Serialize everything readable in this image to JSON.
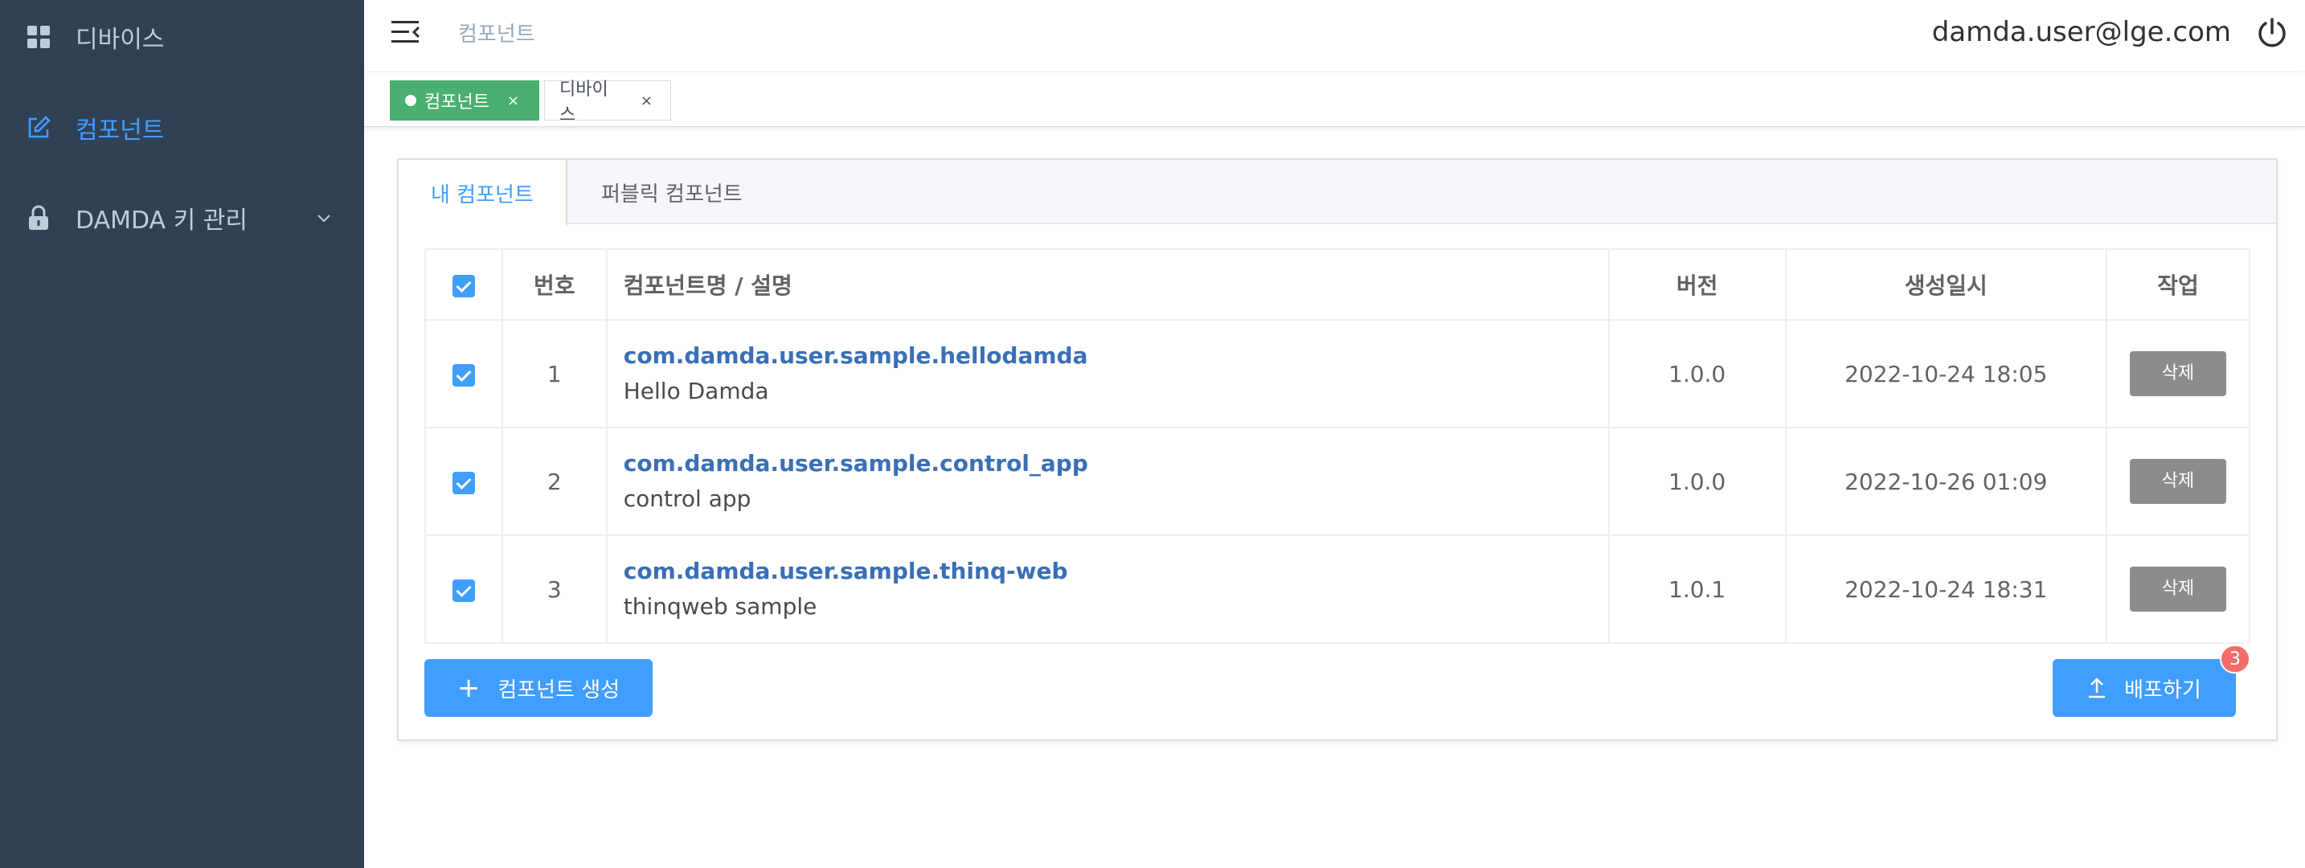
{
  "sidebar": {
    "items": [
      {
        "label": "디바이스",
        "icon": "dashboard-icon"
      },
      {
        "label": "컴포넌트",
        "icon": "edit-icon",
        "active": true
      },
      {
        "label": "DAMDA 키 관리",
        "icon": "lock-icon",
        "expandable": true
      }
    ]
  },
  "header": {
    "breadcrumb": "컴포넌트",
    "user_email": "damda.user@lge.com"
  },
  "tags": [
    {
      "label": "컴포넌트",
      "close": "×",
      "active": true
    },
    {
      "label": "디바이스",
      "close": "×",
      "active": false
    }
  ],
  "tabs": [
    {
      "label": "내 컴포넌트",
      "active": true
    },
    {
      "label": "퍼블릭 컴포넌트",
      "active": false
    }
  ],
  "table": {
    "headers": {
      "number": "번호",
      "name": "컴포넌트명 / 설명",
      "version": "버전",
      "created": "생성일시",
      "action": "작업"
    },
    "rows": [
      {
        "no": "1",
        "name": "com.damda.user.sample.hellodamda",
        "desc": "Hello Damda",
        "version": "1.0.0",
        "created": "2022-10-24 18:05",
        "action": "삭제",
        "checked": true
      },
      {
        "no": "2",
        "name": "com.damda.user.sample.control_app",
        "desc": "control app",
        "version": "1.0.0",
        "created": "2022-10-26 01:09",
        "action": "삭제",
        "checked": true
      },
      {
        "no": "3",
        "name": "com.damda.user.sample.thinq-web",
        "desc": "thinqweb sample",
        "version": "1.0.1",
        "created": "2022-10-24 18:31",
        "action": "삭제",
        "checked": true
      }
    ]
  },
  "buttons": {
    "create": "컴포넌트 생성",
    "deploy": "배포하기",
    "deploy_badge": "3"
  },
  "colors": {
    "sidebar_bg": "#304156",
    "accent": "#409eff",
    "active_tag": "#4aaf6f",
    "delete_btn": "#8c8c8c",
    "badge": "#f56c6c"
  }
}
